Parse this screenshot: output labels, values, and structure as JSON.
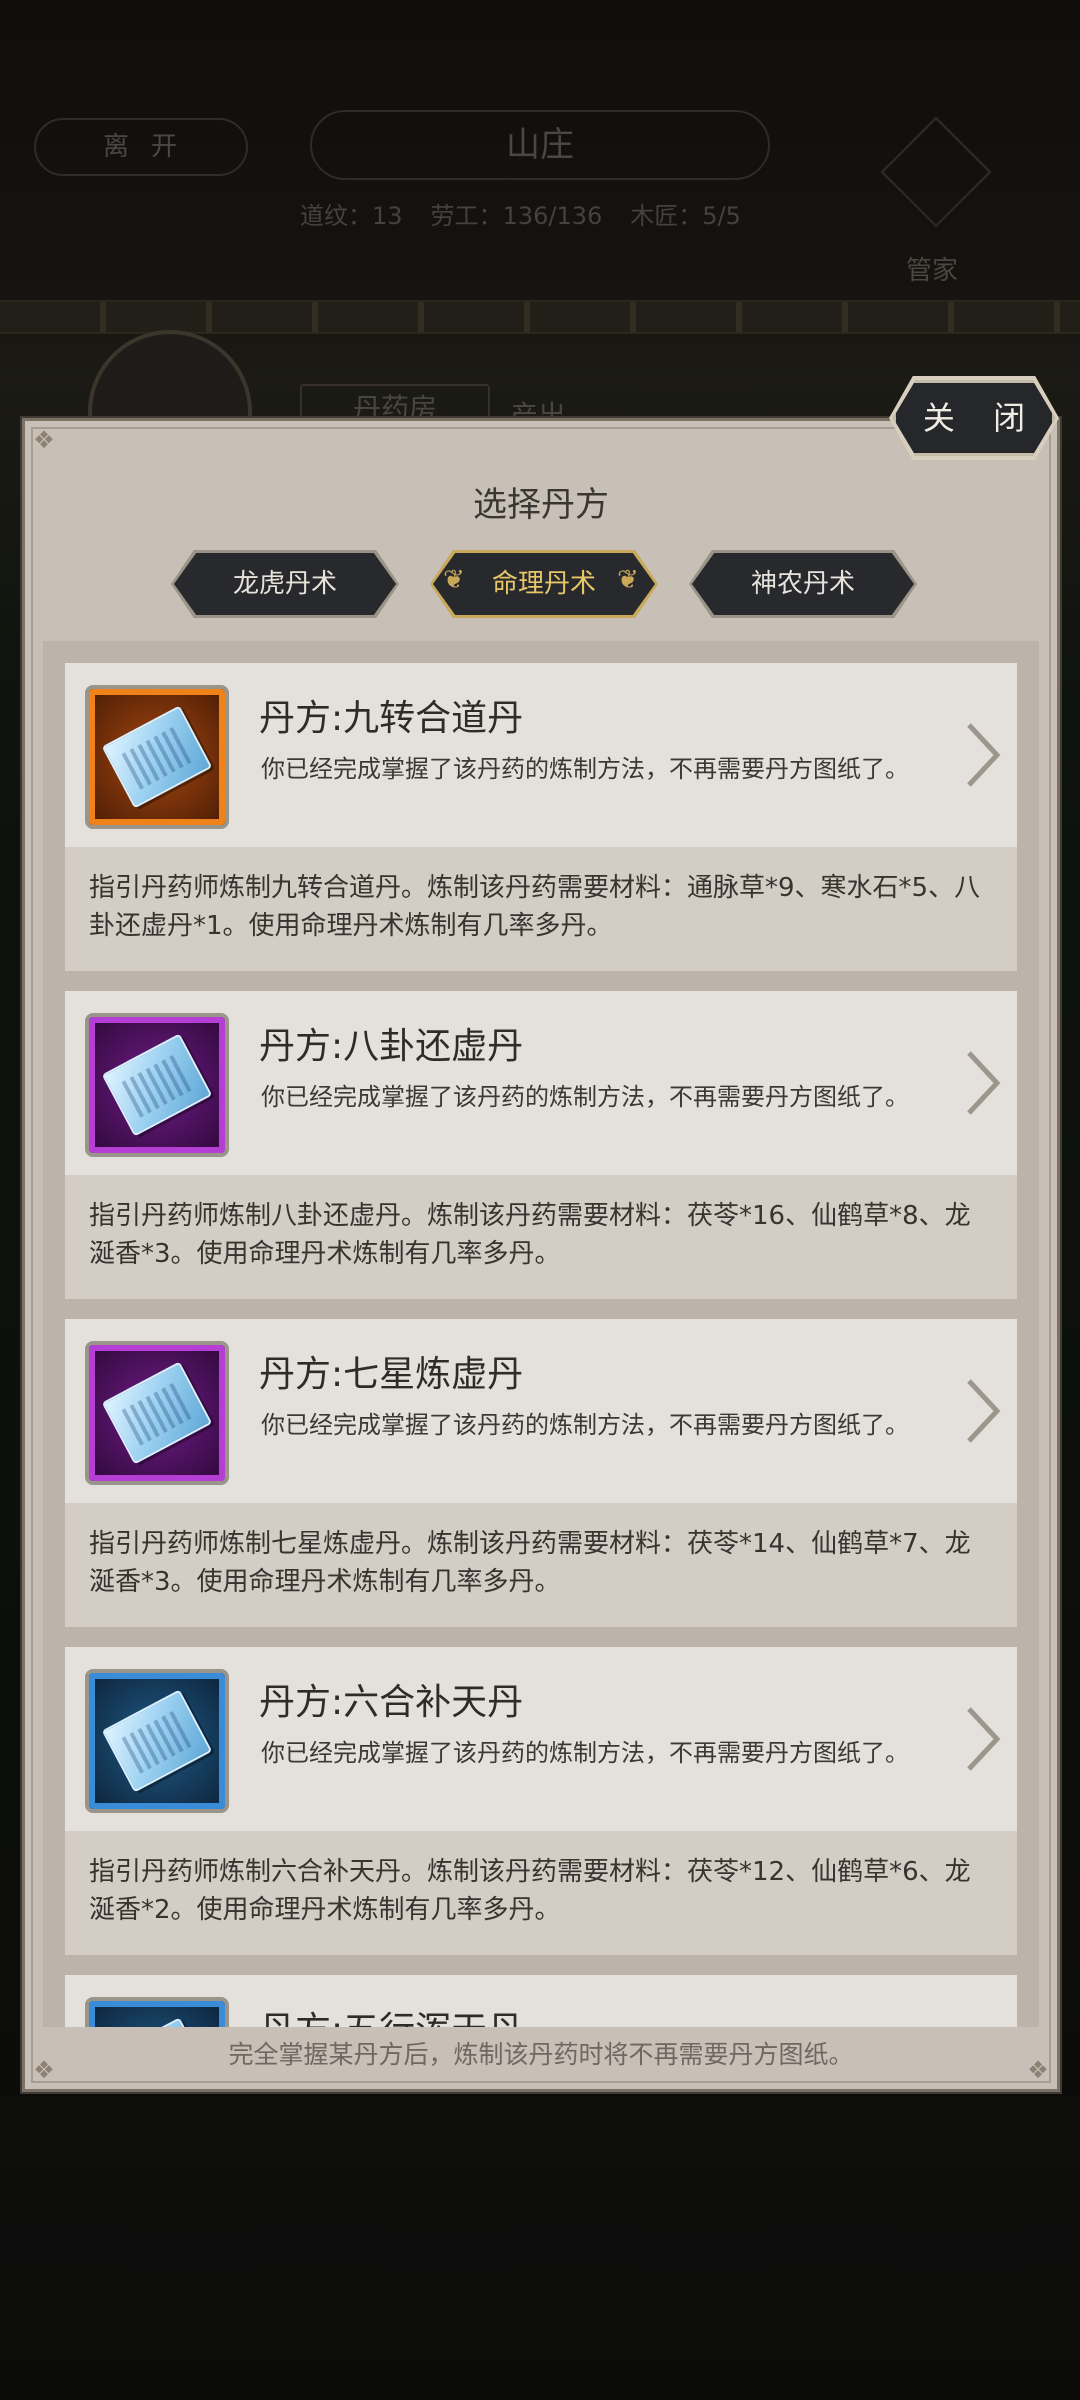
{
  "background": {
    "leave_label": "离开",
    "title": "山庄",
    "stats": [
      "道纹：13",
      "劳工：136/136",
      "木匠：5/5"
    ],
    "steward_label": "管家",
    "tab_left": "丹药房",
    "tab_right": "产出"
  },
  "dialog": {
    "close_label": "关 闭",
    "title": "选择丹方",
    "tabs": [
      {
        "label": "龙虎丹术",
        "active": false
      },
      {
        "label": "命理丹术",
        "active": true
      },
      {
        "label": "神农丹术",
        "active": false
      }
    ],
    "recipes": [
      {
        "title": "丹方:九转合道丹",
        "status": "你已经完成掌握了该丹药的炼制方法，不再需要丹方图纸了。",
        "description": "指引丹药师炼制九转合道丹。炼制该丹药需要材料：通脉草*9、寒水石*5、八卦还虚丹*1。使用命理丹术炼制有几率多丹。",
        "rarity": "orange"
      },
      {
        "title": "丹方:八卦还虚丹",
        "status": "你已经完成掌握了该丹药的炼制方法，不再需要丹方图纸了。",
        "description": "指引丹药师炼制八卦还虚丹。炼制该丹药需要材料：茯苓*16、仙鹤草*8、龙涎香*3。使用命理丹术炼制有几率多丹。",
        "rarity": "purple"
      },
      {
        "title": "丹方:七星炼虚丹",
        "status": "你已经完成掌握了该丹药的炼制方法，不再需要丹方图纸了。",
        "description": "指引丹药师炼制七星炼虚丹。炼制该丹药需要材料：茯苓*14、仙鹤草*7、龙涎香*3。使用命理丹术炼制有几率多丹。",
        "rarity": "purple"
      },
      {
        "title": "丹方:六合补天丹",
        "status": "你已经完成掌握了该丹药的炼制方法，不再需要丹方图纸了。",
        "description": "指引丹药师炼制六合补天丹。炼制该丹药需要材料：茯苓*12、仙鹤草*6、龙涎香*2。使用命理丹术炼制有几率多丹。",
        "rarity": "blue"
      },
      {
        "title": "丹方:五行浑天丹",
        "status": "",
        "description": "",
        "rarity": "blue"
      }
    ],
    "footer_note": "完全掌握某丹方后，炼制该丹药时将不再需要丹方图纸。"
  },
  "colors": {
    "panel_bg": "#c8c0b7",
    "card_head_bg": "#e4e0dc",
    "card_body_bg": "#d3cdc6",
    "active_tab_text": "#e7c66a",
    "rarity_orange": "#f0821a",
    "rarity_purple": "#b43ed6",
    "rarity_blue": "#3a8bd8"
  },
  "icons": {
    "recipe_icon": "recipe-scroll-icon",
    "chevron": "chevron-right-icon",
    "corner": "corner-ornament-icon"
  }
}
